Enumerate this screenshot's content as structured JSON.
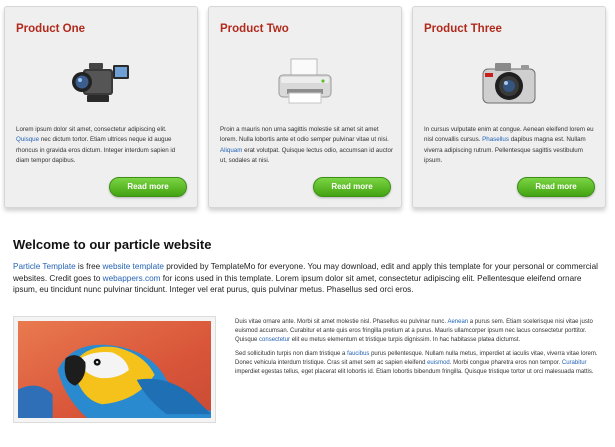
{
  "products": [
    {
      "title": "Product One",
      "icon": "camcorder-icon",
      "text_before": "Lorem ipsum dolor sit amet, consectetur adipiscing elit. ",
      "link": "Quisque",
      "text_after": " nec dictum tortor. Etiam ultrices neque id augue rhoncus in gravida eros dictum. Integer interdum sapien id diam tempor dapibus.",
      "button": "Read more"
    },
    {
      "title": "Product Two",
      "icon": "printer-icon",
      "text_before": "Proin a mauris non urna sagittis molestie sit amet sit amet lorem. Nulla lobortis ante et odio semper pulvinar vitae ut nisi. ",
      "link": "Aliquam",
      "text_after": " erat volutpat. Quisque lectus odio, accumsan id auctor ut, sodales at nisi.",
      "button": "Read more"
    },
    {
      "title": "Product Three",
      "icon": "camera-icon",
      "text_before": "In cursus vulputate enim at congue. Aenean eleifend lorem eu nisl convallis cursus. ",
      "link": "Phasellus",
      "text_after": " dapibus magna est. Nullam viverra adipiscing rutrum. Pellentesque sagittis vestibulum ipsum.",
      "button": "Read more"
    }
  ],
  "welcome": {
    "title": "Welcome to our particle website",
    "link1": "Particle Template",
    "t1": " is free ",
    "link2": "website template",
    "t2": " provided by TemplateMo for everyone. You may download, edit and apply this template for your personal or commercial websites. Credit goes to ",
    "link3": "webappers.com",
    "t3": " for icons used in this template. Lorem ipsum dolor sit amet, consectetur adipiscing elit. Pellentesque eleifend ornare ipsum, eu tincidunt nunc pulvinar tincidunt. Integer vel erat purus, quis pulvinar metus. Phasellus sed orci eros."
  },
  "body": {
    "p1_a": "Duis vitae ornare ante. Morbi sit amet molestie nisl. Phasellus eu pulvinar nunc. ",
    "p1_link1": "Aenean",
    "p1_b": " a purus sem. Etiam scelerisque nisi vitae justo euismod accumsan. Curabitur et ante quis eros fringilla pretium at a purus. Mauris ullamcorper ipsum nec lacus consectetur porttitor. Quisque ",
    "p1_link2": "consectetur",
    "p1_c": " elit eu metus elementum et tristique turpis dignissim. In hac habitasse platea dictumst.",
    "p2_a": "Sed sollicitudin turpis non diam tristique a ",
    "p2_link1": "faucibus",
    "p2_b": " purus pellentesque. Nullam nulla metus, imperdiet at iaculis vitae, viverra vitae lorem. Donec vehicula interdum tristique. Cras sit amet sem ac sapien eleifend ",
    "p2_link2": "euismod",
    "p2_c": ". Morbi congue pharetra eros non tempor. ",
    "p2_link3": "Curabitur",
    "p2_d": " imperdiet egestas tellus, eget placerat elit lobortis id. Etiam lobortis bibendum fringilla. Quisque tristique tortor ut orci malesuada mattis."
  },
  "image": {
    "subject": "macaw-parrot-photo"
  },
  "colors": {
    "title_red": "#b12a1c",
    "link_blue": "#2463b4",
    "button_green": "#5cbf2a"
  }
}
